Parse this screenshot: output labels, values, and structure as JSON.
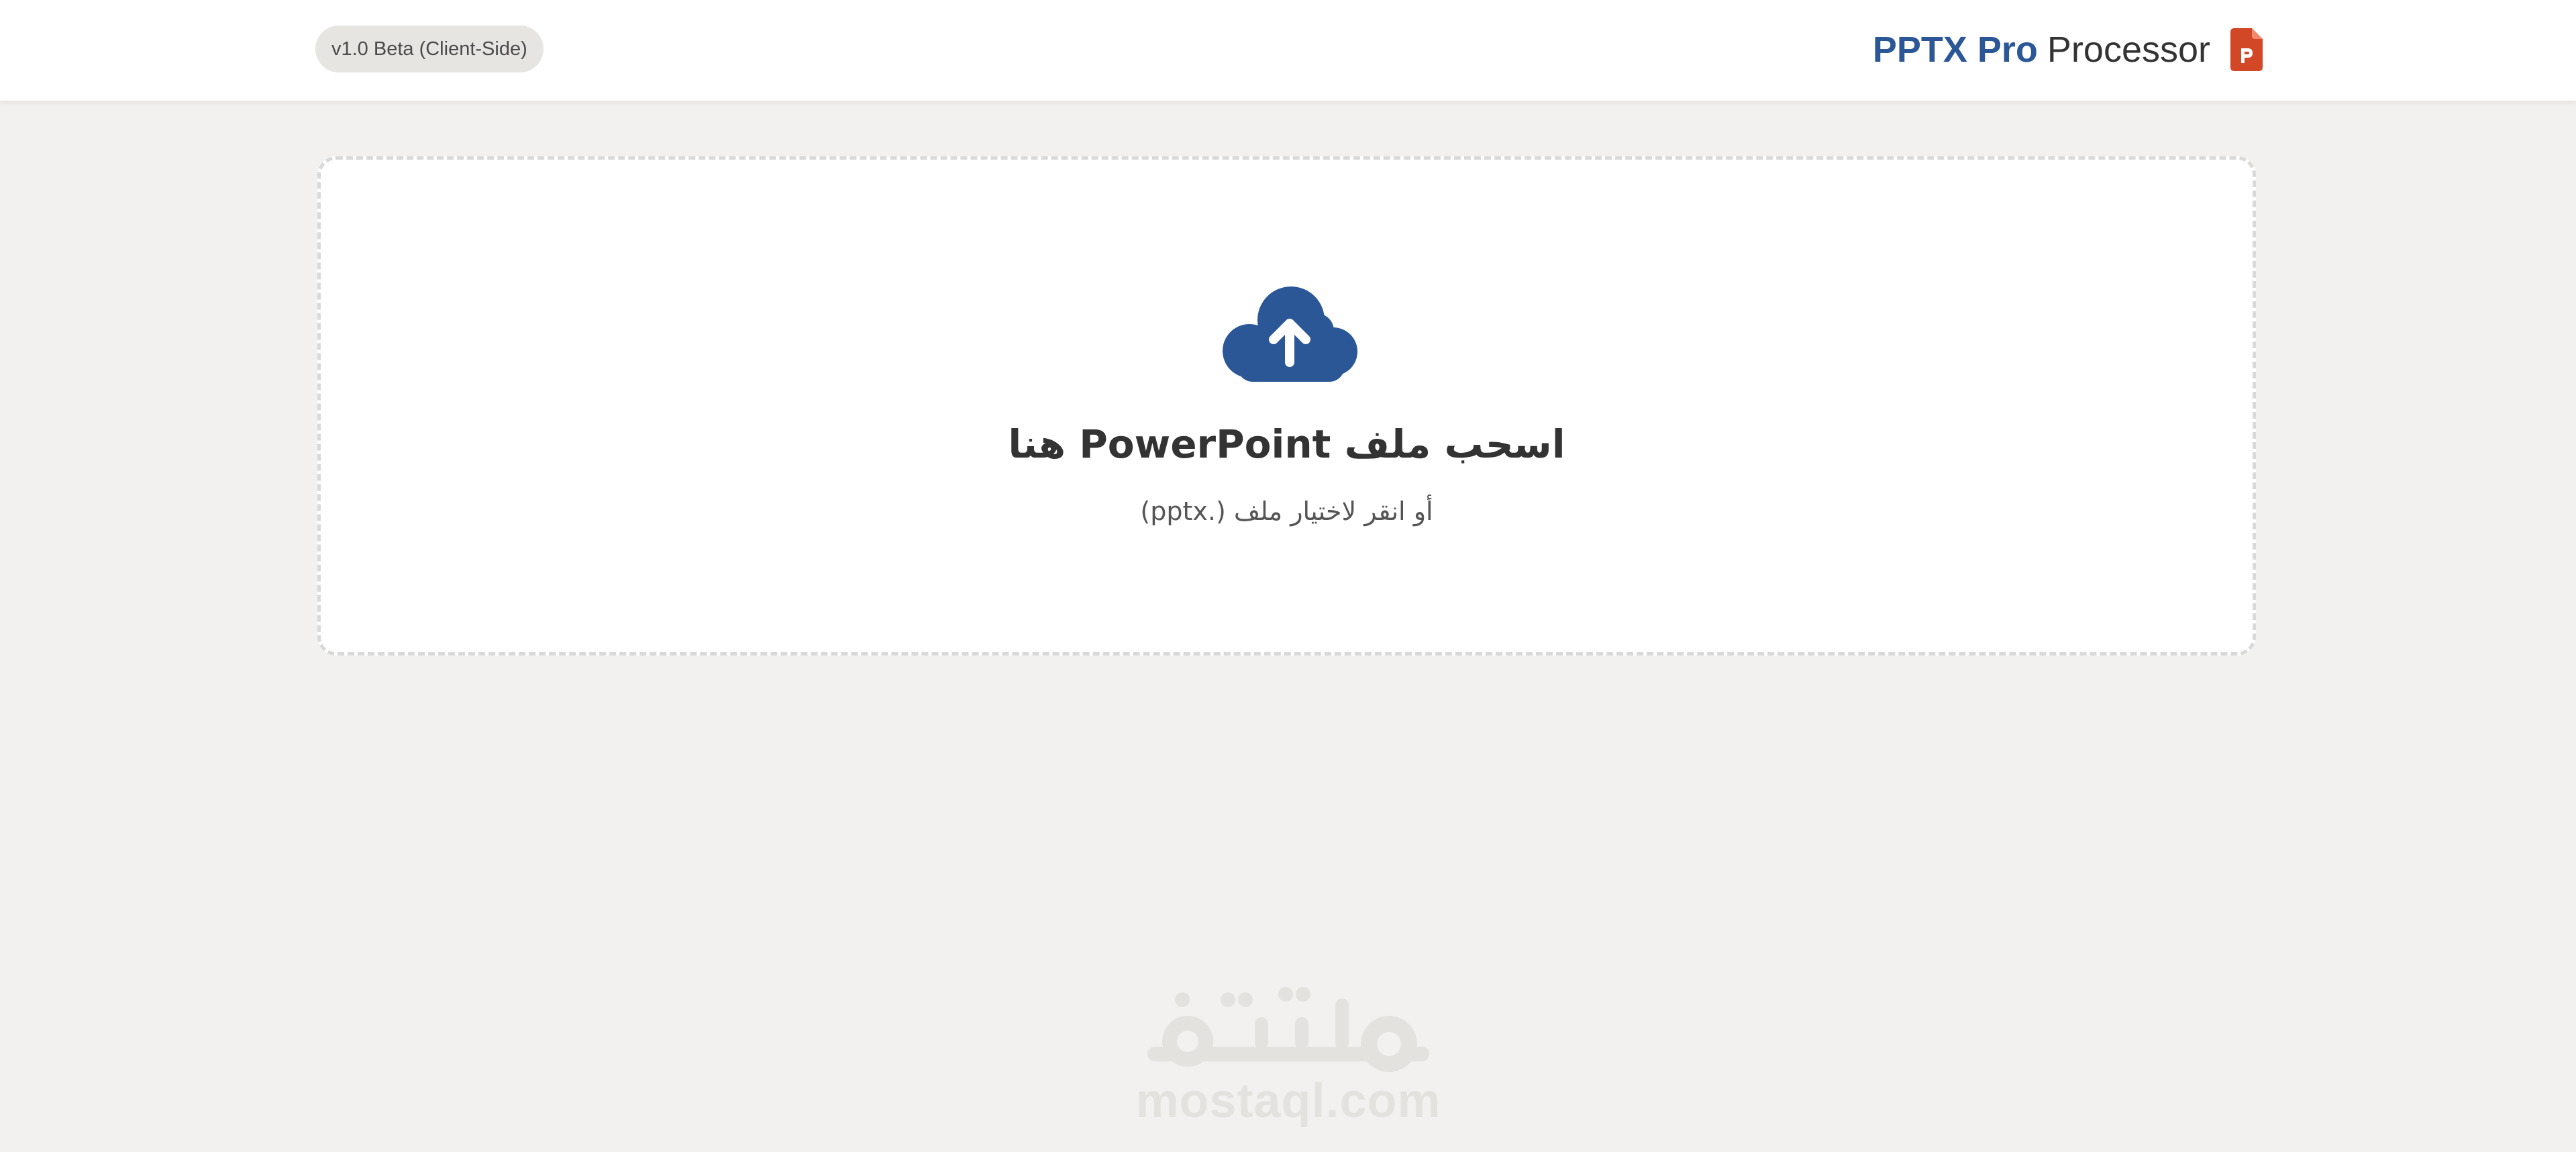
{
  "header": {
    "version_badge": "v1.0 Beta (Client-Side)",
    "brand": {
      "strong": "PPTX Pro",
      "light": "Processor",
      "icon": "powerpoint-file-icon",
      "icon_color": "#d24726",
      "strong_color": "#2b5797"
    }
  },
  "dropzone": {
    "icon": "cloud-upload-icon",
    "icon_color": "#2b5797",
    "title": "اسحب ملف PowerPoint هنا",
    "subtitle": "أو انقر لاختيار ملف (.pptx)"
  },
  "watermark": {
    "logo_text": "مستقل",
    "domain": "mostaql.com"
  }
}
